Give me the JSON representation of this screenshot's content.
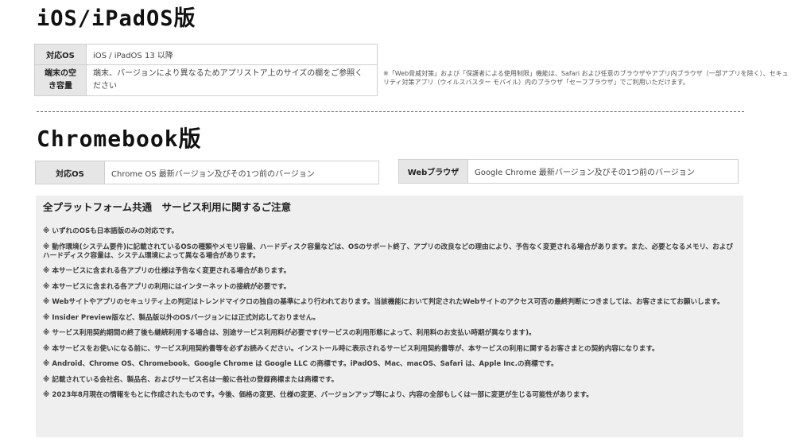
{
  "ios": {
    "title": "iOS/iPadOS版",
    "rows": [
      {
        "label": "対応OS",
        "value": "iOS / iPadOS 13 以降"
      },
      {
        "label": "端末の空き容量",
        "value": "端末、バージョンにより異なるためアプリストア上のサイズの欄をご参照ください"
      }
    ],
    "note": "※「Web脅威対策」および「保護者による使用制限」機能は、Safari および任意のブラウザやアプリ内ブラウザ（一部アプリを除く）、セキュリティ対策アプリ（ウイルスバスター モバイル）内のブラウザ「セーフブラウザ」でご利用いただけます。"
  },
  "chromebook": {
    "title": "Chromebook版",
    "os_label": "対応OS",
    "os_value": "Chrome OS 最新バージョン及びその1つ前のバージョン",
    "browser_label": "Webブラウザ",
    "browser_value": "Google Chrome 最新バージョン及びその1つ前のバージョン"
  },
  "notice": {
    "title": "全プラットフォーム共通　サービス利用に関するご注意",
    "items": [
      "※ いずれのOSも日本語版のみの対応です。",
      "※ 動作環境(システム要件)に記載されているOSの種類やメモリ容量、ハードディスク容量などは、OSのサポート終了、アプリの改良などの理由により、予告なく変更される場合があります。また、必要となるメモリ、およびハードディスク容量は、システム環境によって異なる場合があります。",
      "※ 本サービスに含まれる各アプリの仕様は予告なく変更される場合があります。",
      "※ 本サービスに含まれる各アプリの利用にはインターネットの接続が必要です。",
      "※ Webサイトやアプリのセキュリティ上の判定はトレンドマイクロの独自の基準により行われております。当該機能において判定されたWebサイトのアクセス可否の最終判断につきましては、お客さまにてお願いします。",
      "※ Insider Preview版など、製品版以外のOSバージョンには正式対応しておりません。",
      "※ サービス利用契約期間の終了後も継続利用する場合は、別途サービス利用料が必要です(サービスの利用形態によって、利用料のお支払い時期が異なります)。",
      "※ 本サービスをお使いになる前に、サービス利用契約書等を必ずお読みください。インストール時に表示されるサービス利用契約書等が、本サービスの利用に関するお客さまとの契約内容になります。",
      "※ Android、Chrome OS、Chromebook、Google Chrome は Google LLC の商標です。iPadOS、Mac、macOS、Safari は、Apple Inc.の商標です。",
      "※ 記載されている会社名、製品名、およびサービス名は一般に各社の登録商標または商標です。",
      "※ 2023年8月現在の情報をもとに作成されたものです。今後、価格の変更、仕様の変更、バージョンアップ等により、内容の全部もしくは一部に変更が生じる可能性があります。"
    ]
  }
}
